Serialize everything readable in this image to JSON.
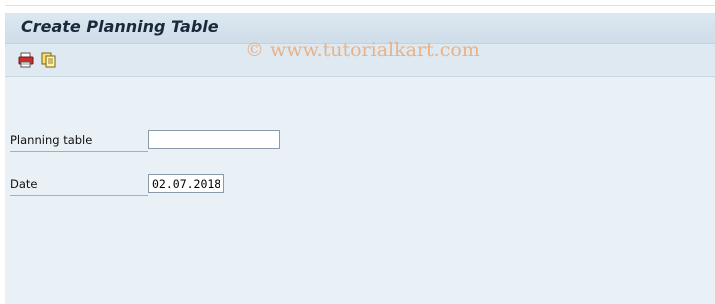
{
  "window": {
    "title": "Create Planning Table"
  },
  "toolbar": {
    "buttons": [
      {
        "icon": "print-icon"
      },
      {
        "icon": "copy-icon"
      }
    ]
  },
  "watermark": {
    "text": "© www.tutorialkart.com"
  },
  "form": {
    "planning_table": {
      "label": "Planning table",
      "value": ""
    },
    "date": {
      "label": "Date",
      "value": "02.07.2018"
    }
  },
  "colors": {
    "background": "#eaf1f6",
    "title_bar": "#d4e1ec",
    "watermark": "#e9b083"
  }
}
